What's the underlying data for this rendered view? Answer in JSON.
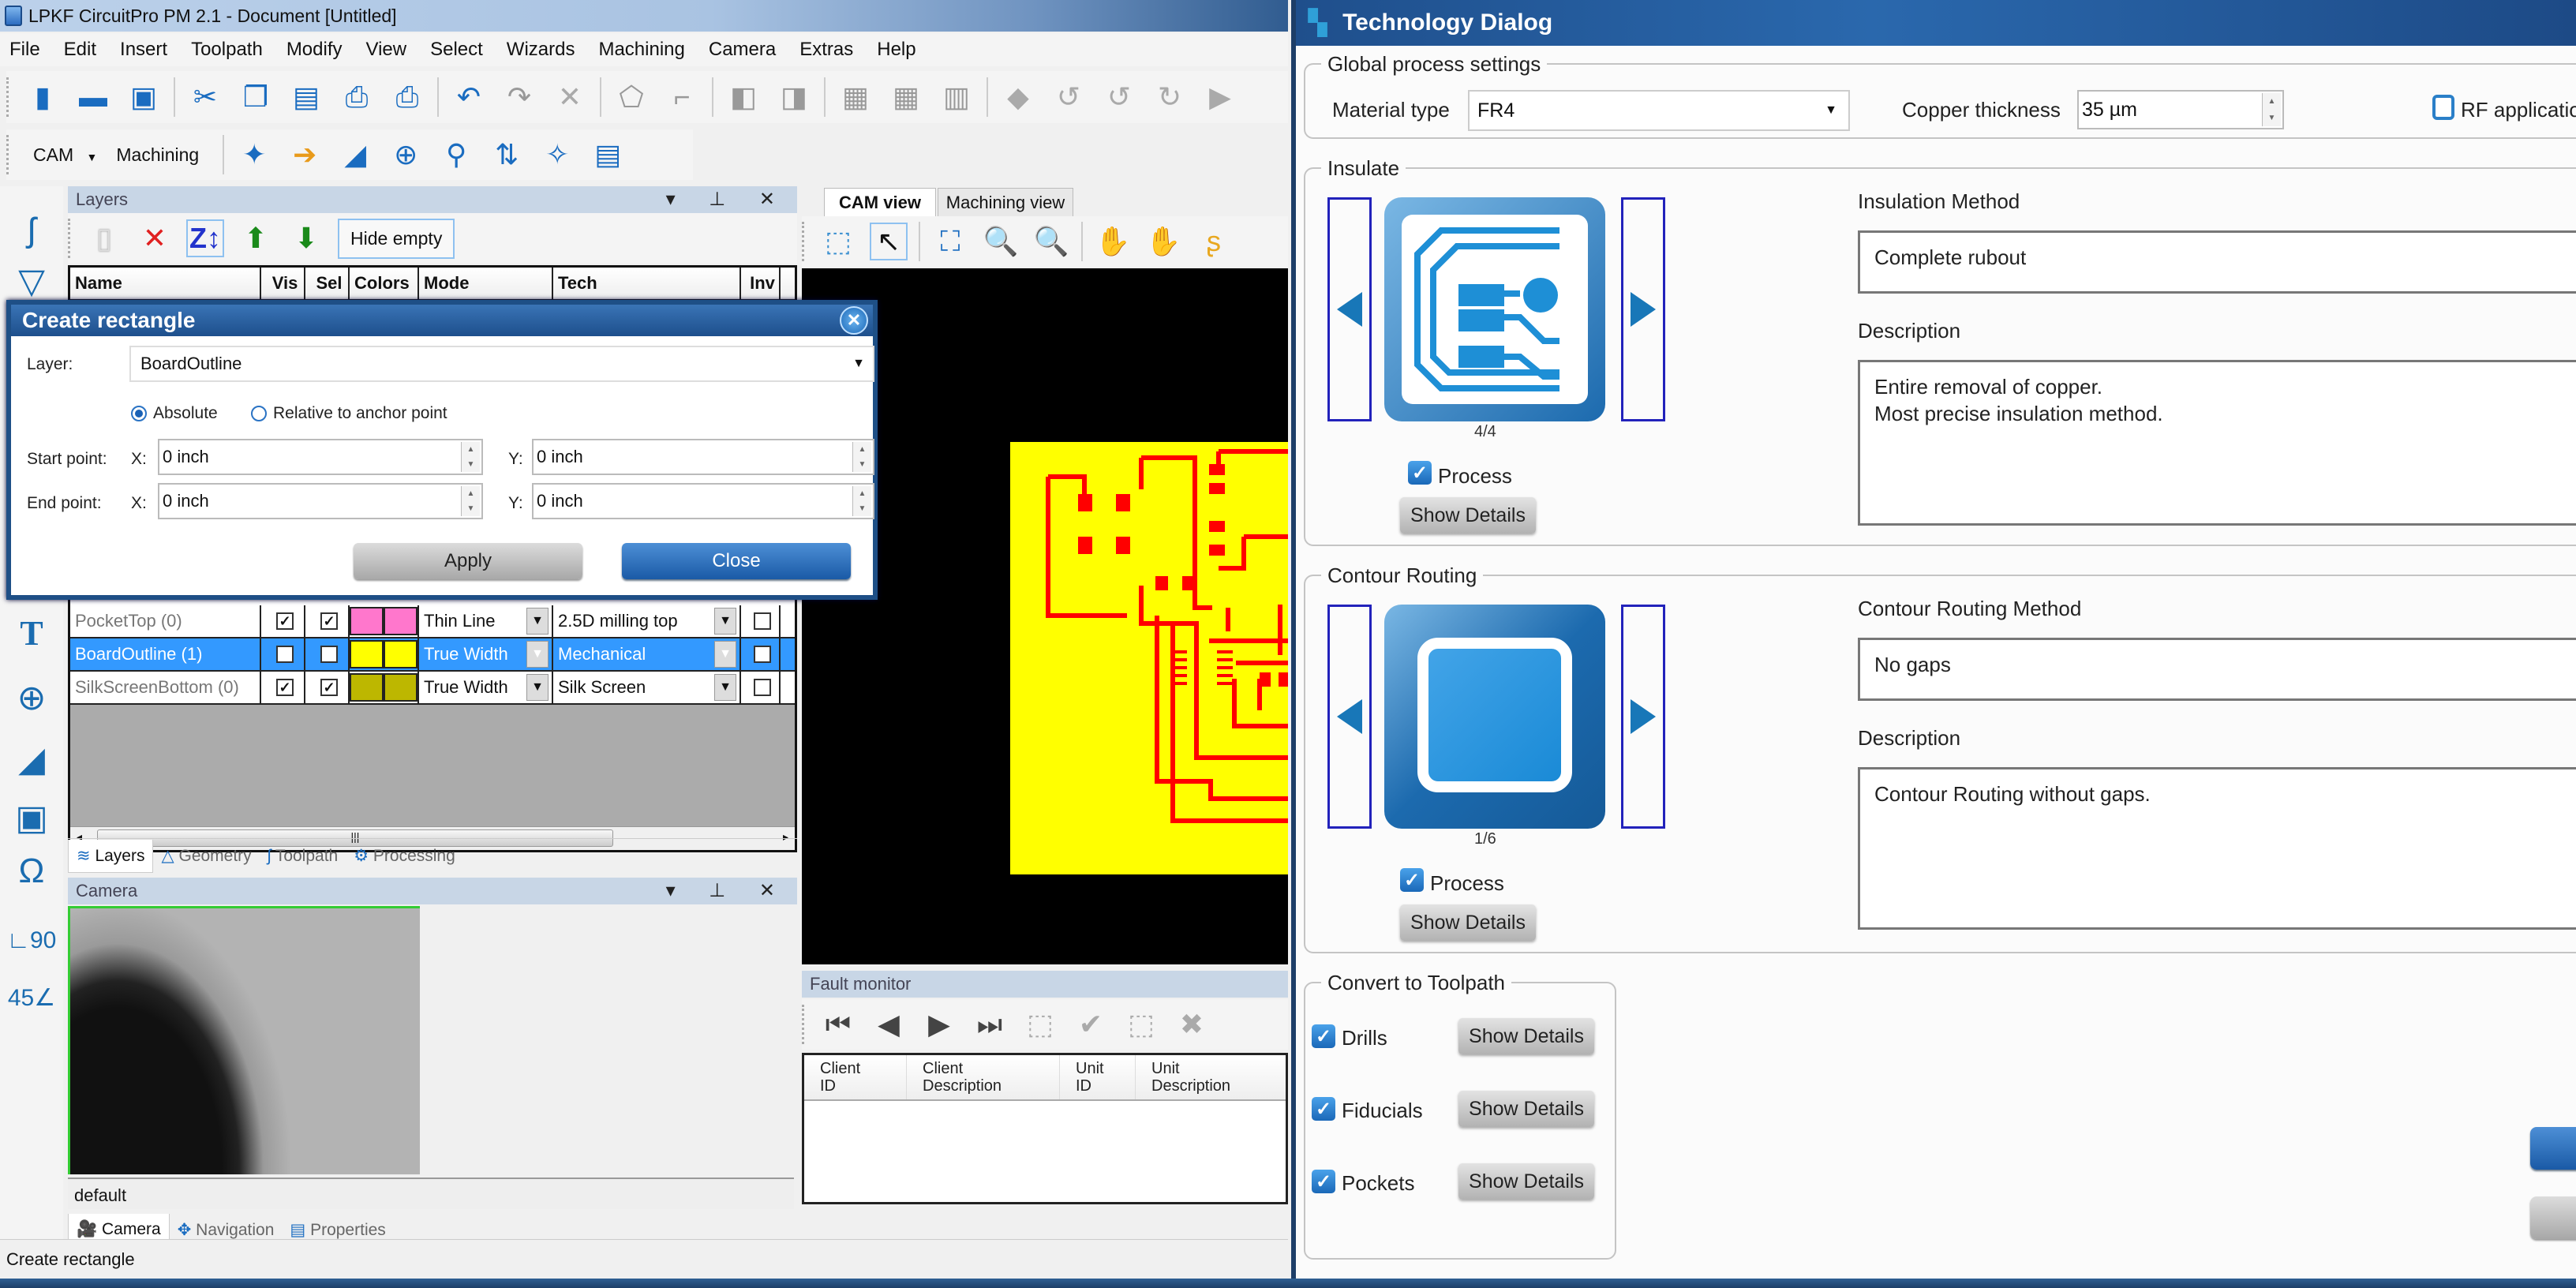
{
  "app": {
    "title": "LPKF CircuitPro PM 2.1 - Document [Untitled]",
    "menu": [
      "File",
      "Edit",
      "Insert",
      "Toolpath",
      "Modify",
      "View",
      "Select",
      "Wizards",
      "Machining",
      "Camera",
      "Extras",
      "Help"
    ],
    "toolbar_mode": {
      "cam_label": "CAM",
      "machining_label": "Machining"
    },
    "status_text": "Create rectangle"
  },
  "layers_panel": {
    "title": "Layers",
    "hide_empty_label": "Hide empty",
    "columns": [
      "Name",
      "Vis",
      "Sel",
      "Colors",
      "Mode",
      "Tech",
      "Inv"
    ],
    "rows": [
      {
        "name": "PocketTop (0)",
        "vis": true,
        "sel": true,
        "color": "#ff77cc",
        "mode": "Thin Line",
        "tech": "2.5D milling top",
        "inv": false,
        "selected": false,
        "empty": true
      },
      {
        "name": "BoardOutline (1)",
        "vis": true,
        "sel": true,
        "color": "#ffff00",
        "mode": "True Width",
        "tech": "Mechanical",
        "inv": false,
        "selected": true,
        "empty": false
      },
      {
        "name": "SilkScreenBottom (0)",
        "vis": true,
        "sel": true,
        "color": "#bdb700",
        "mode": "True Width",
        "tech": "Silk Screen",
        "inv": false,
        "selected": false,
        "empty": true
      }
    ],
    "bottom_tabs": [
      "Layers",
      "Geometry",
      "Toolpath",
      "Processing"
    ]
  },
  "create_rectangle": {
    "title": "Create rectangle",
    "layer_label": "Layer:",
    "layer_value": "BoardOutline",
    "mode_absolute": "Absolute",
    "mode_relative": "Relative to anchor point",
    "mode_selected": "Absolute",
    "start_label": "Start point:",
    "end_label": "End point:",
    "x_label": "X:",
    "y_label": "Y:",
    "start_x": "0 inch",
    "start_y": "0 inch",
    "end_x": "0 inch",
    "end_y": "0 inch",
    "apply_label": "Apply",
    "close_label": "Close"
  },
  "cam_view": {
    "tabs": [
      "CAM view",
      "Machining view"
    ],
    "active_tab": "CAM view",
    "board_color": "#ffff00",
    "trace_color": "#ff0000"
  },
  "fault_monitor": {
    "title": "Fault monitor",
    "columns": [
      [
        "Client",
        "ID"
      ],
      [
        "Client",
        "Description"
      ],
      [
        "Unit",
        "ID"
      ],
      [
        "Unit",
        "Description"
      ]
    ]
  },
  "camera_panel": {
    "title": "Camera",
    "profile": "default",
    "bottom_tabs": [
      "Camera",
      "Navigation",
      "Properties"
    ]
  },
  "technology_dialog": {
    "title": "Technology Dialog",
    "global": {
      "group_title": "Global process settings",
      "material_label": "Material type",
      "material_value": "FR4",
      "copper_label": "Copper thickness",
      "copper_value": "35 µm",
      "rf_label": "RF application",
      "rf_checked": false
    },
    "insulate": {
      "group_title": "Insulate",
      "counter": "4/4",
      "process_label": "Process",
      "process_checked": true,
      "show_details": "Show Details",
      "method_label": "Insulation Method",
      "method_value": "Complete rubout",
      "description_label": "Description",
      "description_lines": [
        "Entire removal of copper.",
        "Most precise insulation method."
      ]
    },
    "contour": {
      "group_title": "Contour Routing",
      "counter": "1/6",
      "process_label": "Process",
      "process_checked": true,
      "show_details": "Show Details",
      "method_label": "Contour Routing Method",
      "method_value": "No gaps",
      "description_label": "Description",
      "description_lines": [
        "Contour Routing without gaps."
      ]
    },
    "convert": {
      "group_title": "Convert to Toolpath",
      "items": [
        {
          "label": "Drills",
          "checked": true,
          "button": "Show Details"
        },
        {
          "label": "Fiducials",
          "checked": true,
          "button": "Show Details"
        },
        {
          "label": "Pockets",
          "checked": true,
          "button": "Show Details"
        }
      ]
    }
  }
}
